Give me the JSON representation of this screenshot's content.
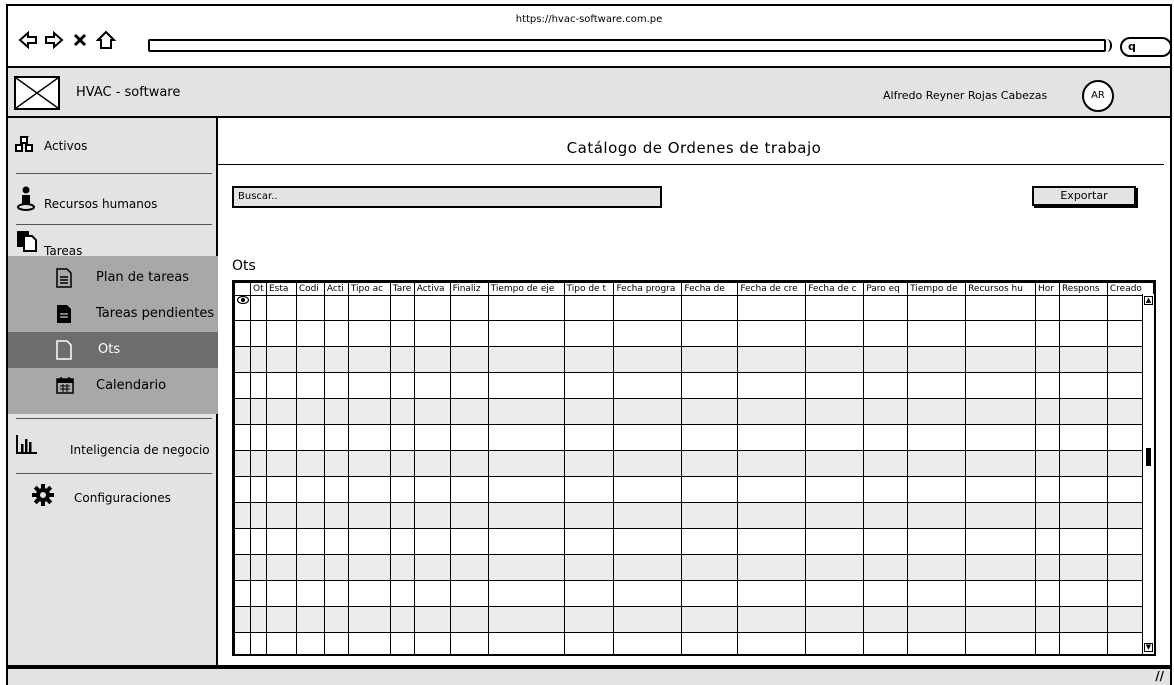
{
  "browser": {
    "url": "https://hvac-software.com.pe",
    "search_glyph": "q"
  },
  "header": {
    "app_title": "HVAC - software",
    "user_name": "Alfredo Reyner Rojas Cabezas",
    "avatar_initials": "AR"
  },
  "sidebar": {
    "items": [
      {
        "label": "Activos",
        "icon": "cubes-icon"
      },
      {
        "label": "Recursos humanos",
        "icon": "person-icon"
      },
      {
        "label": "Tareas",
        "icon": "documents-icon"
      },
      {
        "label": "Inteligencia de negocio",
        "icon": "bar-chart-icon"
      },
      {
        "label": "Configuraciones",
        "icon": "gear-icon"
      }
    ],
    "subitems": [
      {
        "label": "Plan de tareas",
        "icon": "document-lines-icon"
      },
      {
        "label": "Tareas pendientes",
        "icon": "document-filled-icon"
      },
      {
        "label": "Ots",
        "icon": "document-outline-icon",
        "active": true
      },
      {
        "label": "Calendario",
        "icon": "calendar-icon"
      }
    ]
  },
  "main": {
    "title": "Catálogo de Ordenes de trabajo",
    "search_placeholder": "Buscar..",
    "export_label": "Exportar",
    "section_label": "Ots",
    "columns": [
      "Ot",
      "Esta",
      "Codi",
      "Acti",
      "Tipo ac",
      "Tare",
      "Activa",
      "Finaliz",
      "Tiempo de eje",
      "Tipo de t",
      "Fecha progra",
      "Fecha de",
      "Fecha de cre",
      "Fecha de c",
      "Paro eq",
      "Tiempo de",
      "Recursos hu",
      "Hor",
      "Respons",
      "Creado"
    ],
    "row_count": 14
  },
  "colors": {
    "panel_gray": "#e3e3e3",
    "subnav_gray": "#a8a8a8",
    "active_gray": "#6d6d6d",
    "row_alt": "#ebebeb"
  }
}
